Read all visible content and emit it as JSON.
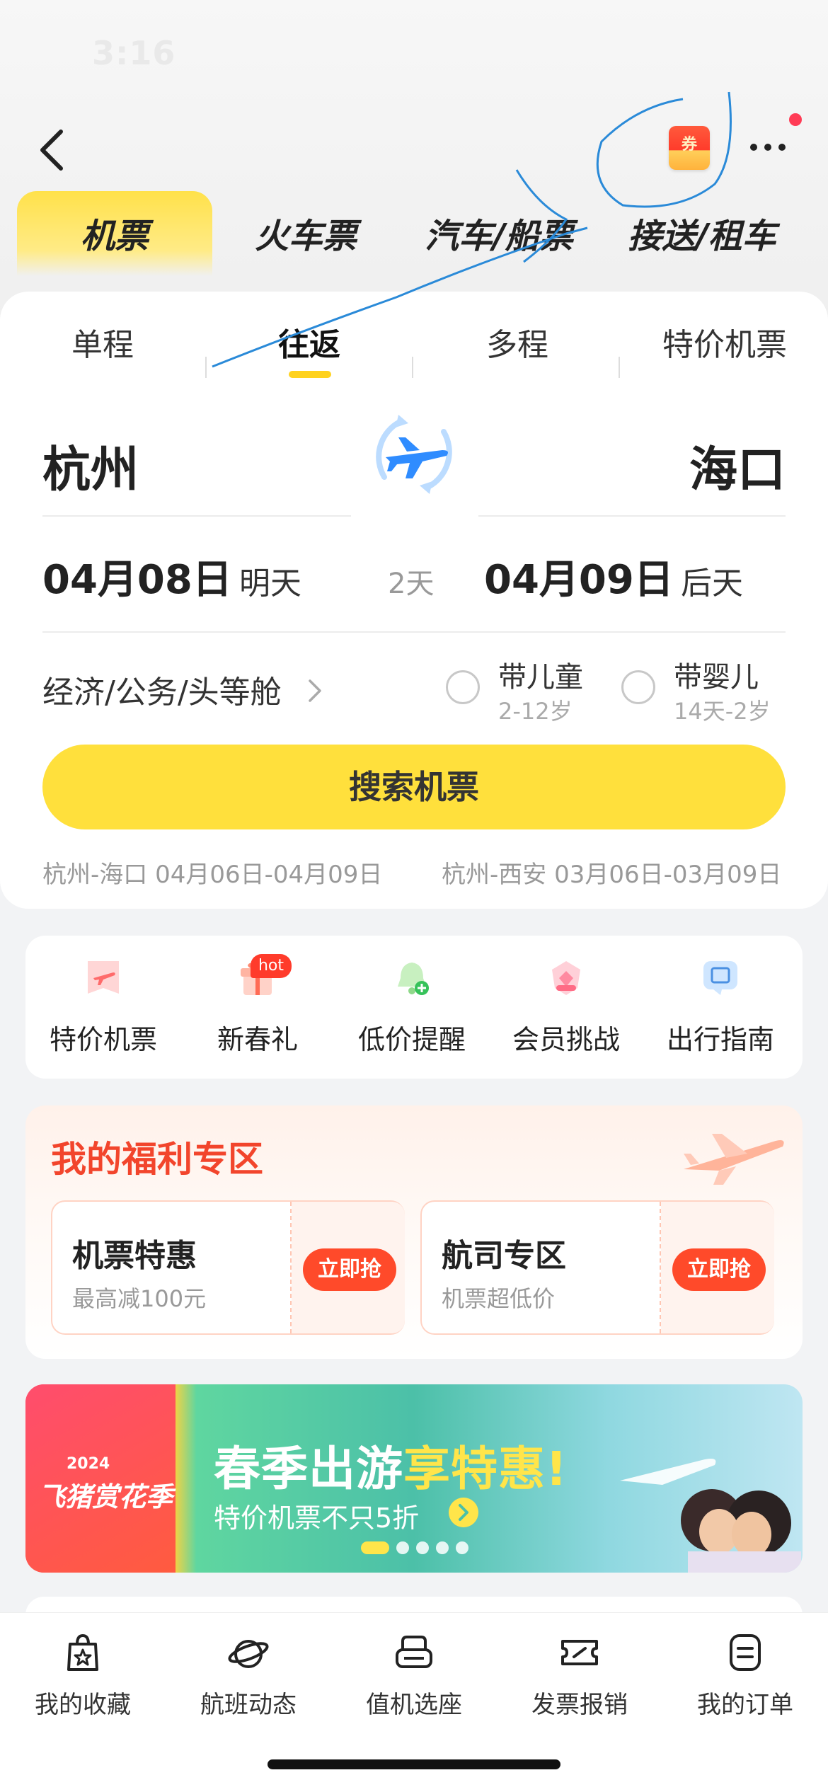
{
  "status_bar": {
    "time": "3:16"
  },
  "header": {
    "coupon_label": "券",
    "accent_color": "#ffe03c"
  },
  "mode_tabs": [
    {
      "label": "机票",
      "active": true
    },
    {
      "label": "火车票",
      "active": false
    },
    {
      "label": "汽车/船票",
      "active": false
    },
    {
      "label": "接送/租车",
      "active": false
    }
  ],
  "trip_tabs": [
    {
      "label": "单程",
      "active": false
    },
    {
      "label": "往返",
      "active": true
    },
    {
      "label": "多程",
      "active": false
    },
    {
      "label": "特价机票",
      "active": false
    }
  ],
  "route": {
    "from_city": "杭州",
    "to_city": "海口"
  },
  "dates": {
    "depart_date": "04月08日",
    "depart_day": "明天",
    "duration": "2天",
    "return_date": "04月09日",
    "return_day": "后天"
  },
  "cabin": {
    "label": "经济/公务/头等舱"
  },
  "passengers": {
    "child_label": "带儿童",
    "child_range": "2-12岁",
    "infant_label": "带婴儿",
    "infant_range": "14天-2岁"
  },
  "search_button": "搜索机票",
  "history": [
    "杭州-海口 04月06日-04月09日",
    "杭州-西安 03月06日-03月09日"
  ],
  "quick_entries": [
    {
      "label": "特价机票",
      "icon": "plane-tag-icon"
    },
    {
      "label": "新春礼",
      "icon": "gift-icon",
      "badge": "hot"
    },
    {
      "label": "低价提醒",
      "icon": "bell-plus-icon"
    },
    {
      "label": "会员挑战",
      "icon": "member-shield-icon"
    },
    {
      "label": "出行指南",
      "icon": "question-bubble-icon"
    }
  ],
  "welfare": {
    "title": "我的福利专区",
    "deals": [
      {
        "title": "机票特惠",
        "subtitle": "最高减100元",
        "button": "立即抢"
      },
      {
        "title": "航司专区",
        "subtitle": "机票超低价",
        "button": "立即抢"
      }
    ]
  },
  "banner": {
    "year": "2024",
    "brand": "飞猪赏花季",
    "title_main": "春季出游",
    "title_highlight": "享特惠!",
    "subtitle": "特价机票不只5折"
  },
  "bottom_nav": [
    {
      "label": "我的收藏",
      "icon": "bag-star-icon"
    },
    {
      "label": "航班动态",
      "icon": "planet-icon"
    },
    {
      "label": "值机选座",
      "icon": "seat-icon"
    },
    {
      "label": "发票报销",
      "icon": "ticket-icon"
    },
    {
      "label": "我的订单",
      "icon": "order-icon"
    }
  ]
}
